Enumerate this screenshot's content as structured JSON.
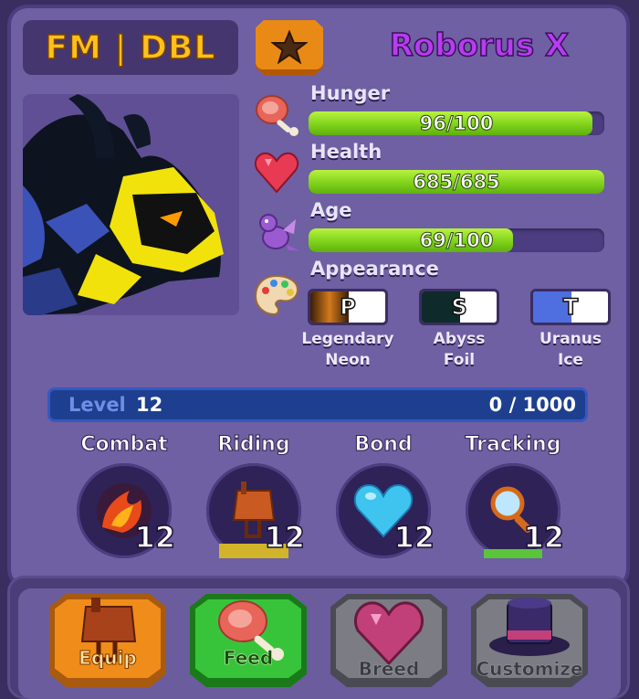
{
  "header": {
    "tag": "FM | DBL",
    "pet_name": "Roborus X"
  },
  "stats": {
    "hunger": {
      "label": "Hunger",
      "value": "96/100",
      "fraction": 0.96
    },
    "health": {
      "label": "Health",
      "value": "685/685",
      "fraction": 1.0
    },
    "age": {
      "label": "Age",
      "value": "69/100",
      "fraction": 0.69
    },
    "appearance_label": "Appearance"
  },
  "appearance": [
    {
      "letter": "P",
      "name_line1": "Legendary",
      "name_line2": "Neon",
      "color_left": "#6b3d12",
      "color_right": "#ffffff"
    },
    {
      "letter": "S",
      "name_line1": "Abyss",
      "name_line2": "Foil",
      "color_left": "#0f2a2a",
      "color_right": "#f2f2f2"
    },
    {
      "letter": "T",
      "name_line1": "Uranus",
      "name_line2": "Ice",
      "color_left": "#4f6ee0",
      "color_right": "#ffffff"
    }
  ],
  "level": {
    "label": "Level",
    "value": "12",
    "xp": "0 / 1000"
  },
  "skills": [
    {
      "label": "Combat",
      "level": "12",
      "icon": "flame-claw-icon"
    },
    {
      "label": "Riding",
      "level": "12",
      "icon": "saddle-icon"
    },
    {
      "label": "Bond",
      "level": "12",
      "icon": "heart-icon"
    },
    {
      "label": "Tracking",
      "level": "12",
      "icon": "magnifier-icon"
    }
  ],
  "actions": [
    {
      "label": "Equip",
      "icon": "saddle-icon",
      "color": "#f08c1a"
    },
    {
      "label": "Feed",
      "icon": "meat-icon",
      "color": "#38c43a"
    },
    {
      "label": "Breed",
      "icon": "heart-gem-icon",
      "color": "#7c7c84"
    },
    {
      "label": "Customize",
      "icon": "top-hat-icon",
      "color": "#7c7c84"
    }
  ],
  "colors": {
    "accent_name": "#b63df0",
    "tag_text": "#ffc01c",
    "bar_fill": "#7fd21a",
    "level_bar": "#1e3f8f"
  }
}
